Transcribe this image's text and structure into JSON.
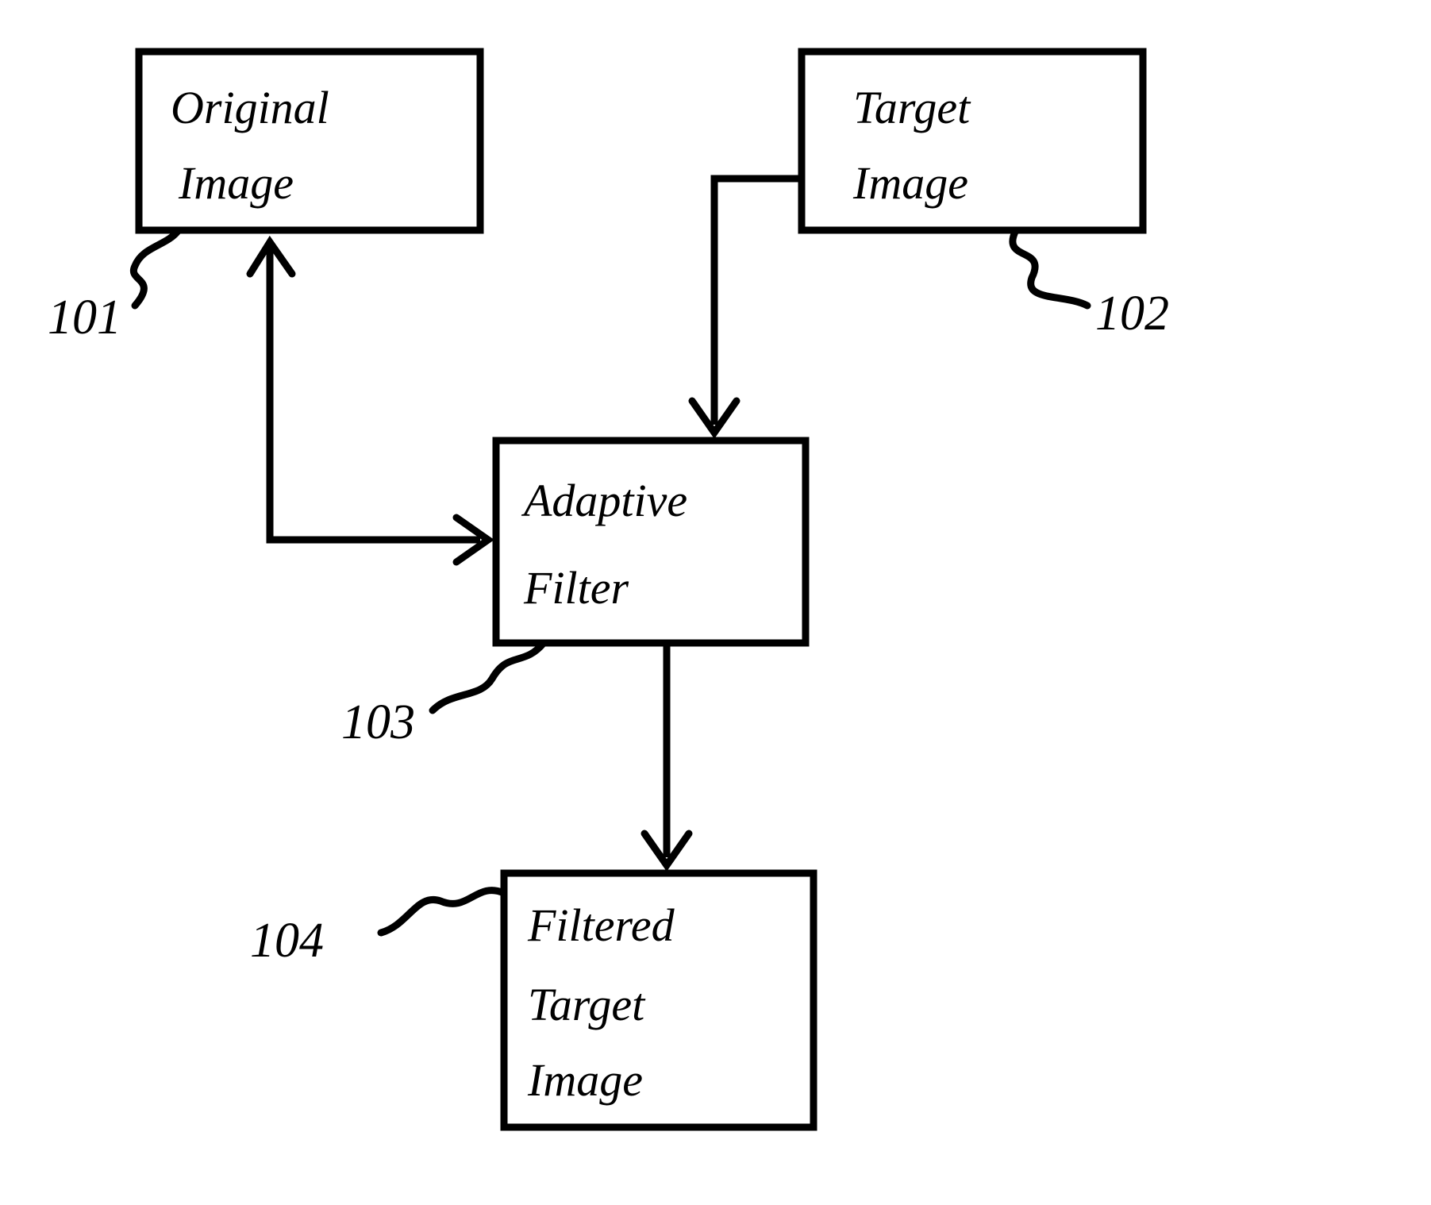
{
  "boxes": {
    "original": {
      "line1": "Original",
      "line2": "Image",
      "ref": "101"
    },
    "target": {
      "line1": "Target",
      "line2": "Image",
      "ref": "102"
    },
    "filter": {
      "line1": "Adaptive",
      "line2": "Filter",
      "ref": "103"
    },
    "result": {
      "line1": "Filtered",
      "line2": "Target",
      "line3": "Image",
      "ref": "104"
    }
  },
  "chart_data": {
    "type": "flowchart",
    "nodes": [
      {
        "id": "101",
        "label": "Original Image"
      },
      {
        "id": "102",
        "label": "Target Image"
      },
      {
        "id": "103",
        "label": "Adaptive Filter"
      },
      {
        "id": "104",
        "label": "Filtered Target Image"
      }
    ],
    "edges": [
      {
        "from": "101",
        "to": "103",
        "bidirectional": true
      },
      {
        "from": "102",
        "to": "103"
      },
      {
        "from": "103",
        "to": "104"
      }
    ]
  }
}
